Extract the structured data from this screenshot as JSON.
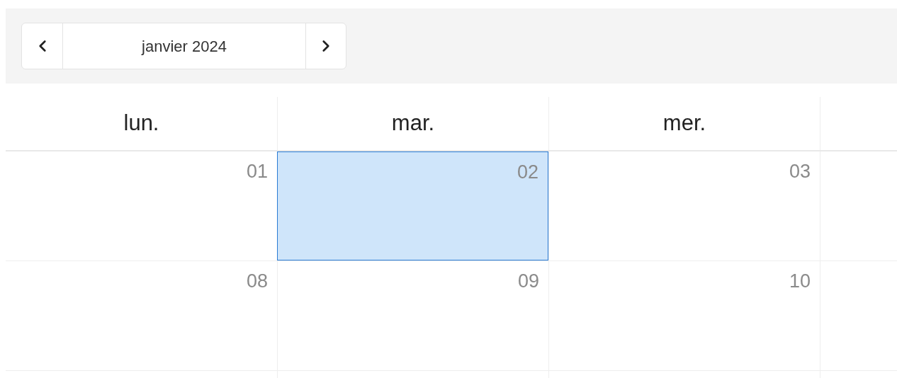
{
  "toolbar": {
    "month_label": "janvier 2024"
  },
  "weekdays": [
    "lun.",
    "mar.",
    "mer."
  ],
  "weeks": [
    {
      "days": [
        {
          "label": "01",
          "selected": false
        },
        {
          "label": "02",
          "selected": true
        },
        {
          "label": "03",
          "selected": false
        }
      ]
    },
    {
      "days": [
        {
          "label": "08",
          "selected": false
        },
        {
          "label": "09",
          "selected": false
        },
        {
          "label": "10",
          "selected": false
        }
      ]
    }
  ]
}
